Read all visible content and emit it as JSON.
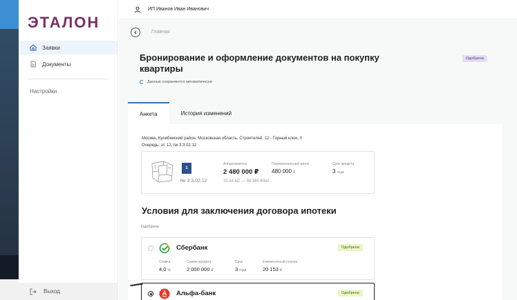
{
  "brand": {
    "logo_text": "ЭТАЛОН",
    "logo_color": "#7a2f66"
  },
  "sidebar": {
    "items": [
      {
        "label": "Заявки",
        "icon": "home-icon",
        "active": true
      },
      {
        "label": "Документы",
        "icon": "document-icon",
        "active": false
      }
    ],
    "settings_label": "Настройки",
    "exit_label": "Выход",
    "exit_icon": "logout-icon"
  },
  "topbar": {
    "user_name": "ИП Иванов Иван Иванович",
    "user_icon": "user-icon"
  },
  "breadcrumb": {
    "back_icon": "chevron-left-icon",
    "current": "Главная"
  },
  "page": {
    "title": "Бронирование и оформление документов на покупку квартиры",
    "status": "Одобрена",
    "autosave": "Данные сохраняются автоматически"
  },
  "tabs": [
    {
      "label": "Анкета",
      "active": true
    },
    {
      "label": "История изменений",
      "active": false
    }
  ],
  "apartment": {
    "address": "Москва, Кулибинский район, Московская область, Строителей, 12 - Горный ключ, II Очередь, эт. 12, № 3.3.02.12",
    "rooms": "1",
    "code": "№ 3.3.02.12",
    "price_label": "Аппартаменты",
    "price": "2 480 000 ₽",
    "down_payment_label": "Первоначальный взнос",
    "down_payment": "480 000",
    "down_payment_unit": "₽",
    "term_label": "Срок кредита",
    "term": "3",
    "term_unit": "года",
    "area": "33.44 м2 — 98 385 ₽/м2"
  },
  "mortgage": {
    "section_title": "Условия для заключения договора ипотеки",
    "group_label": "Одобрена",
    "banks": [
      {
        "name": "Сбербанк",
        "logo": "sberbank-logo-icon",
        "badge": "Одобрена",
        "selected": false,
        "rate_label": "Ставка",
        "rate": "4,0",
        "rate_unit": "%",
        "amount_label": "Сумма кредита",
        "amount": "2 000 000",
        "amount_unit": "₽",
        "term_label": "Срок",
        "term": "3",
        "term_unit": "года",
        "payment_label": "Ежемесячный платеж",
        "payment": "20 153",
        "payment_unit": "₽"
      },
      {
        "name": "Альфа-банк",
        "logo": "alfabank-logo-icon",
        "badge": "Одобрена",
        "selected": true
      }
    ]
  },
  "colors": {
    "accent": "#3b6fb0",
    "status_purple_bg": "#e3def3",
    "status_green_bg": "#e9f6c5",
    "sber_green": "#21a038",
    "alfa_red": "#ef3124"
  }
}
